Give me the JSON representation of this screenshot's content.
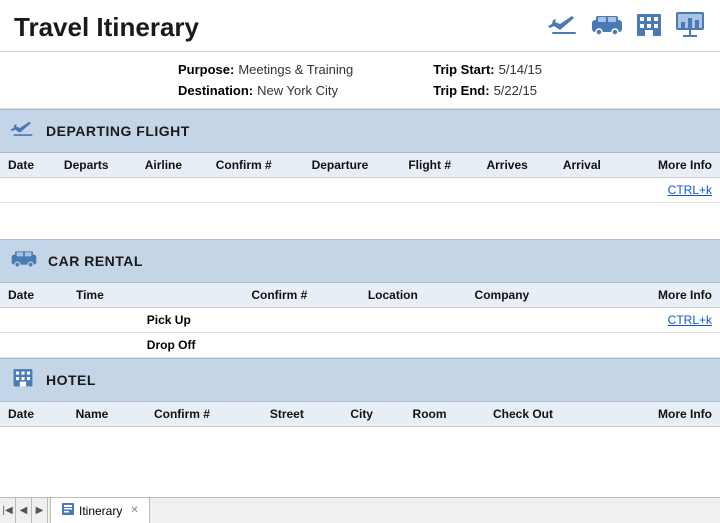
{
  "page": {
    "title": "Travel Itinerary"
  },
  "info": {
    "purpose_label": "Purpose:",
    "purpose_value": "Meetings & Training",
    "destination_label": "Destination:",
    "destination_value": "New York City",
    "trip_start_label": "Trip Start:",
    "trip_start_value": "5/14/15",
    "trip_end_label": "Trip End:",
    "trip_end_value": "5/22/15"
  },
  "departing_flight": {
    "title": "DEPARTING FLIGHT",
    "columns": [
      "Date",
      "Departs",
      "Airline",
      "Confirm #",
      "Departure",
      "Flight #",
      "Arrives",
      "Arrival",
      "More Info"
    ],
    "ctrl_link": "CTRL+k"
  },
  "car_rental": {
    "title": "CAR RENTAL",
    "columns": [
      "Date",
      "Time",
      "",
      "Confirm #",
      "Location",
      "Company",
      "",
      "More Info"
    ],
    "pickup_label": "Pick Up",
    "dropoff_label": "Drop Off",
    "ctrl_link": "CTRL+k"
  },
  "hotel": {
    "title": "HOTEL",
    "columns": [
      "Date",
      "Name",
      "Confirm #",
      "Street",
      "City",
      "Room",
      "Check Out",
      "More Info"
    ]
  },
  "tab_bar": {
    "tab_label": "Itinerary"
  }
}
